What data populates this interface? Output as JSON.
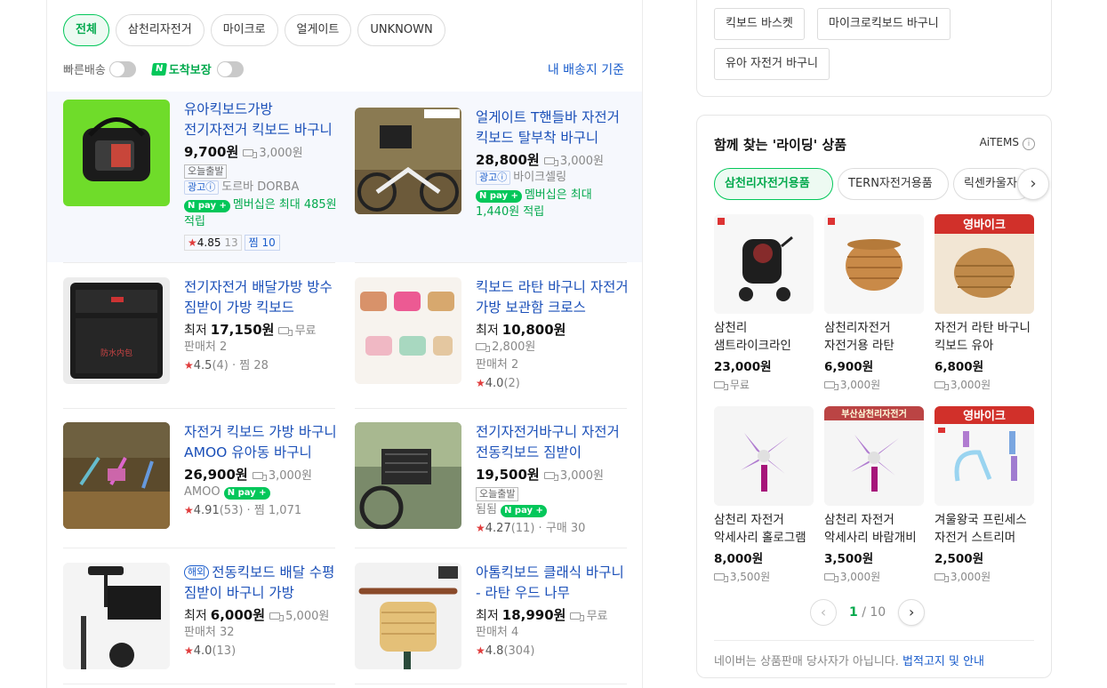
{
  "filters": {
    "chips": [
      "전체",
      "삼천리자전거",
      "마이크로",
      "얼게이트",
      "UNKNOWN"
    ],
    "fast_delivery": "빠른배송",
    "arrival_guarantee": "도착보장",
    "naver_n": "N",
    "address": "내 배송지 기준"
  },
  "products": [
    {
      "title": "유아킥보드가방 전기자전거 킥보드 바구니",
      "price": "9,700원",
      "shipping": "3,000원",
      "tag": "오늘출발",
      "ad": "광고ⓘ",
      "seller": "도르바 DORBA",
      "npay": "N pay +",
      "benefit": "멤버십은 최대 485원 적립",
      "rating": "4.85",
      "reviews": "13",
      "zzim": "찜 10"
    },
    {
      "title": "얼게이트 T핸들바 자전거 킥보드 탈부착 바구니",
      "price": "28,800원",
      "shipping": "3,000원",
      "ad": "광고ⓘ",
      "seller": "바이크셀링",
      "npay": "N pay +",
      "benefit": "멤버십은 최대 1,440원 적립"
    },
    {
      "title": "전기자전거 배달가방 방수 짐받이 가방 킥보드",
      "prefix": "최저",
      "price": "17,150원",
      "shipping": "무료",
      "sellers": "판매처 2",
      "rating": "4.5",
      "reviews": "(4)",
      "zzim": "찜 28"
    },
    {
      "title": "킥보드 라탄 바구니 자전거 가방 보관함 크로스",
      "prefix": "최저",
      "price": "10,800원",
      "shipping": "2,800원",
      "sellers": "판매처 2",
      "rating": "4.0",
      "reviews": "(2)"
    },
    {
      "title": "자전거 킥보드 가방 바구니 AMOO 유아동 바구니",
      "price": "26,900원",
      "shipping": "3,000원",
      "seller": "AMOO",
      "npay": "N pay +",
      "rating": "4.91",
      "reviews": "(53)",
      "zzim": "찜 1,071"
    },
    {
      "title": "전기자전거바구니 자전거 전동킥보드 짐받이",
      "price": "19,500원",
      "shipping": "3,000원",
      "tag": "오늘출발",
      "seller": "됨됨",
      "npay": "N pay +",
      "rating": "4.27",
      "reviews": "(11)",
      "zzim": "구매 30"
    },
    {
      "overseas": "해외",
      "title": "전동킥보드 배달 수평 짐받이 바구니 가방",
      "prefix": "최저",
      "price": "6,000원",
      "shipping": "5,000원",
      "sellers": "판매처 32",
      "rating": "4.0",
      "reviews": "(13)"
    },
    {
      "title": "아톰킥보드 클래식 바구니 - 라탄 우드 나무",
      "prefix": "최저",
      "price": "18,990원",
      "shipping": "무료",
      "sellers": "판매처 4",
      "rating": "4.8",
      "reviews": "(304)"
    }
  ],
  "keywords": [
    "킥보드 바스켓",
    "마이크로킥보드 바구니",
    "유아 자전거 바구니"
  ],
  "recommend": {
    "title": "함께 찾는 '라이딩' 상품",
    "brand": "AiTEMS",
    "tabs": [
      "삼천리자전거용품",
      "TERN자전거용품",
      "릭센카울자"
    ],
    "items": [
      {
        "name": "삼천리 샘트라이크라인 전제품 레인커버",
        "price": "23,000원",
        "shipping": "무료"
      },
      {
        "name": "삼천리자전거 자전거용 라탄 바구니",
        "price": "6,900원",
        "shipping": "3,000원"
      },
      {
        "name": "자전거 라탄 바구니 킥보드 유아",
        "price": "6,800원",
        "shipping": "3,000원"
      },
      {
        "name": "삼천리 자전거 악세사리 홀로그램 바람개비",
        "price": "8,000원",
        "shipping": "3,500원"
      },
      {
        "name": "삼천리 자전거 악세사리 바람개비",
        "price": "3,500원",
        "shipping": "3,000원"
      },
      {
        "name": "겨울왕국 프린세스 자전거 스트리머",
        "price": "2,500원",
        "shipping": "3,000원"
      }
    ],
    "img_label_3": "영바이크",
    "img_label_5": "부산삼천리자전거",
    "img_label_6": "영바이크",
    "page_current": "1",
    "page_total": "/ 10",
    "disclaimer_prefix": "네이버는 상품판매 당사자가 아닙니다.",
    "disclaimer_link": "법적고지 및 안내"
  },
  "colors": {
    "naver_green": "#03c75a",
    "link_blue": "#1a4fb8",
    "star_red": "#e03c3c"
  }
}
